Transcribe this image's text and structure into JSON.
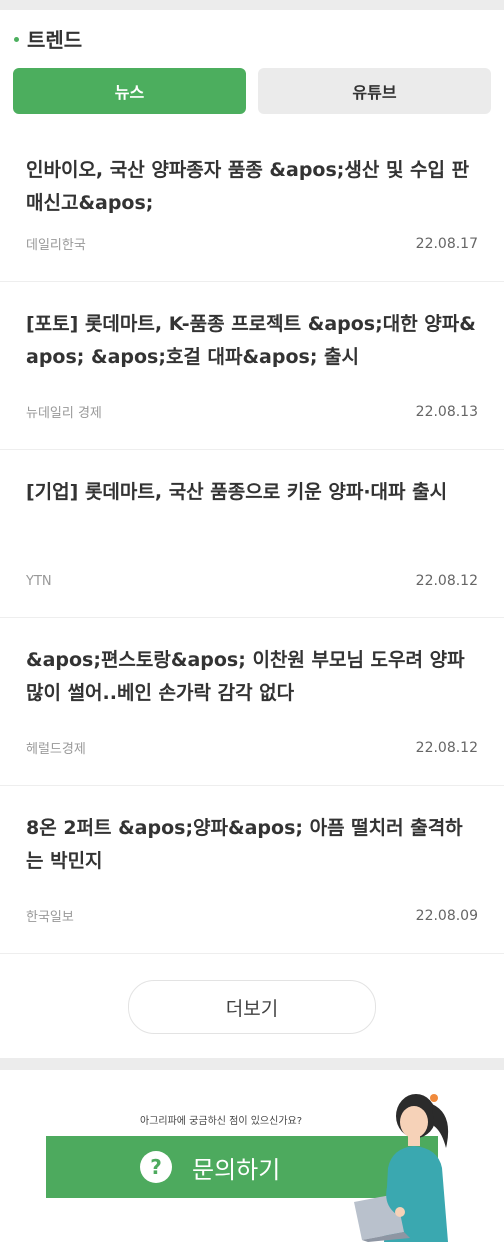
{
  "trend": {
    "title": "트렌드"
  },
  "tabs": [
    {
      "label": "뉴스",
      "active": true
    },
    {
      "label": "유튜브",
      "active": false
    }
  ],
  "news": [
    {
      "title": "인바이오, 국산 양파종자 품종 &apos;생산 및 수입 판매신고&apos;",
      "source": "데일리한국",
      "date": "22.08.17"
    },
    {
      "title": "[포토] 롯데마트, K-품종 프로젝트 &apos;대한 양파&apos; &apos;호걸 대파&apos; 출시",
      "source": "뉴데일리 경제",
      "date": "22.08.13"
    },
    {
      "title": "[기업] 롯데마트, 국산 품종으로 키운 양파·대파 출시",
      "source": "YTN",
      "date": "22.08.12"
    },
    {
      "title": "&apos;편스토랑&apos; 이찬원 부모님 도우려 양파 많이 썰어..베인 손가락 감각 없다",
      "source": "헤럴드경제",
      "date": "22.08.12"
    },
    {
      "title": "8온 2퍼트 &apos;양파&apos; 아픔 떨치러 출격하는 박민지",
      "source": "한국일보",
      "date": "22.08.09"
    }
  ],
  "more_label": "더보기",
  "inquiry": {
    "question": "아그리파에 궁금하신 점이 있으신가요?",
    "icon_glyph": "?",
    "button_label": "문의하기"
  },
  "colors": {
    "accent": "#4cae5e",
    "inactive_tab": "#ebebeb",
    "band": "#ececec"
  }
}
